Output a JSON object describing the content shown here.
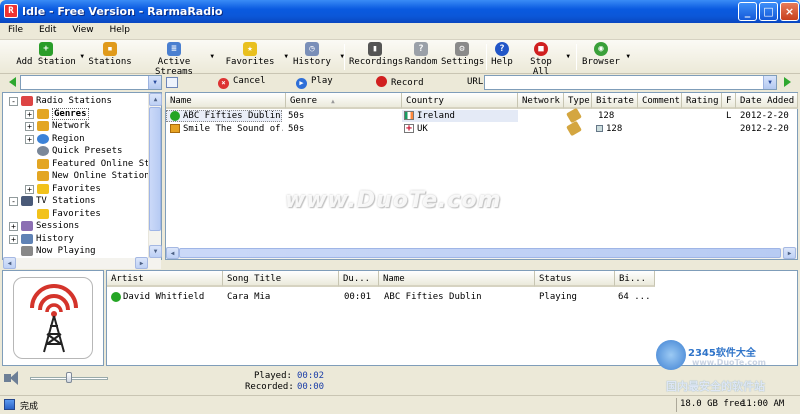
{
  "window": {
    "title": "Idle - Free Version - RarmaRadio",
    "app_icon_letter": "R"
  },
  "window_buttons": {
    "minimize": "_",
    "maximize": "□",
    "close": "×"
  },
  "menu": [
    "File",
    "Edit",
    "View",
    "Help"
  ],
  "toolbar": [
    {
      "label": "Add Station",
      "icon": "add-icon",
      "color": "#2a9d2a",
      "glyph": "+"
    },
    {
      "label": "Stations",
      "icon": "stations-icon",
      "color": "#e09a1b",
      "glyph": "▪"
    },
    {
      "label": "Active Streams",
      "icon": "streams-icon",
      "color": "#4a7fd0",
      "glyph": "≡"
    },
    {
      "label": "Favorites",
      "icon": "star-icon",
      "color": "#e9c01f",
      "glyph": "★"
    },
    {
      "label": "History",
      "icon": "history-icon",
      "color": "#7a8fb8",
      "glyph": "◷"
    },
    {
      "label": "Recordings",
      "icon": "recordings-icon",
      "color": "#555",
      "glyph": "▮"
    },
    {
      "label": "Random",
      "icon": "random-icon",
      "color": "#9aa0a8",
      "glyph": "?"
    },
    {
      "label": "Settings",
      "icon": "settings-icon",
      "color": "#8a8a8a",
      "glyph": "⚙"
    },
    {
      "label": "Help",
      "icon": "help-icon",
      "color": "#2256c7",
      "glyph": "?"
    },
    {
      "label": "Stop All",
      "icon": "stop-icon",
      "color": "#d02020",
      "glyph": "■"
    },
    {
      "label": "Browser",
      "icon": "browser-icon",
      "color": "#3aa03a",
      "glyph": "◉"
    }
  ],
  "actions": {
    "cancel": "Cancel",
    "play": "Play",
    "record": "Record",
    "url_label": "URL"
  },
  "tree": [
    {
      "label": "Radio Stations",
      "level": 0,
      "exp": "-",
      "icon": "radio-icon"
    },
    {
      "label": "Genres",
      "level": 1,
      "exp": "+",
      "icon": "folder-icon",
      "selected": true
    },
    {
      "label": "Network",
      "level": 1,
      "exp": "+",
      "icon": "folder-icon"
    },
    {
      "label": "Region",
      "level": 1,
      "exp": "+",
      "icon": "globe-icon"
    },
    {
      "label": "Quick Presets",
      "level": 1,
      "exp": "",
      "icon": "preset-icon"
    },
    {
      "label": "Featured Online Stat",
      "level": 1,
      "exp": "",
      "icon": "folder-icon"
    },
    {
      "label": "New Online Stations",
      "level": 1,
      "exp": "",
      "icon": "folder-icon"
    },
    {
      "label": "Favorites",
      "level": 1,
      "exp": "+",
      "icon": "star-icon"
    },
    {
      "label": "TV Stations",
      "level": 0,
      "exp": "-",
      "icon": "tv-icon"
    },
    {
      "label": "Favorites",
      "level": 1,
      "exp": "",
      "icon": "star-icon"
    },
    {
      "label": "Sessions",
      "level": 0,
      "exp": "+",
      "icon": "sessions-icon"
    },
    {
      "label": "History",
      "level": 0,
      "exp": "+",
      "icon": "history-icon"
    },
    {
      "label": "Now Playing",
      "level": 0,
      "exp": "",
      "icon": "now-playing-icon"
    }
  ],
  "stations": {
    "columns": [
      "Name",
      "Genre",
      "Country",
      "Network",
      "Type",
      "Bitrate",
      "Comment",
      "Rating",
      "F",
      "Date Added"
    ],
    "rows": [
      {
        "name": "ABC Fifties Dublin",
        "genre": "50s",
        "country": "Ireland",
        "bitrate": "128",
        "f": "L",
        "date": "2012-2-20"
      },
      {
        "name": "Smile The Sound of...",
        "genre": "50s",
        "country": "UK",
        "bitrate": "128",
        "f": "",
        "date": "2012-2-20"
      }
    ]
  },
  "now_playing": {
    "columns": [
      "Artist",
      "Song Title",
      "Du...",
      "Name",
      "Status",
      "Bi..."
    ],
    "rows": [
      {
        "artist": "David Whitfield",
        "song": "Cara Mia",
        "duration": "00:01",
        "name": "ABC Fifties Dublin",
        "status": "Playing",
        "bitrate": "64 ..."
      }
    ]
  },
  "playback": {
    "played_label": "Played:",
    "played": "00:02",
    "recorded_label": "Recorded:",
    "recorded": "00:00",
    "volume": 0.5
  },
  "statusbar": {
    "text": "完成",
    "free": "18.0 GB free",
    "time": "11:00 AM"
  },
  "watermark": "www.DuoTe.com",
  "corner_watermark": {
    "brand": "2345软件大全",
    "url": "www.DuoTe.com",
    "caption": "国内最安全的软件站"
  }
}
